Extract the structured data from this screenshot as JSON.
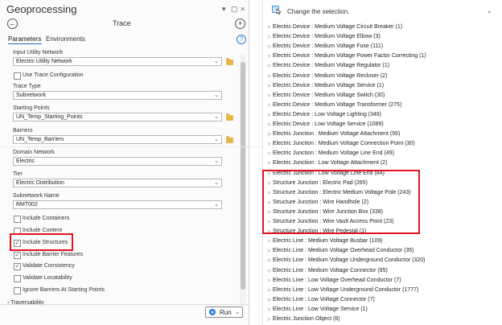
{
  "gp": {
    "title": "Geoprocessing",
    "header_controls": [
      "▾",
      "▢",
      "×"
    ],
    "back": "←",
    "add": "+",
    "tool_title": "Trace",
    "tabs": [
      "Parameters",
      "Environments"
    ],
    "help": "?",
    "input_network_label": "Input Utility Network",
    "input_network_value": "Electric Utility Network",
    "use_trace_config_label": "Use Trace Configuration",
    "trace_type_label": "Trace Type",
    "trace_type_value": "Subnetwork",
    "starting_points_label": "Starting Points",
    "starting_points_value": "UN_Temp_Starting_Points",
    "barriers_label": "Barriers",
    "barriers_value": "UN_Temp_Barriers",
    "domain_network_label": "Domain Network",
    "domain_network_value": "Electric",
    "tier_label": "Tier",
    "tier_value": "Electric Distribution",
    "subnetwork_name_label": "Subnetwork Name",
    "subnetwork_name_value": "RMT002",
    "checkboxes": [
      {
        "label": "Include Containers",
        "checked": false
      },
      {
        "label": "Include Content",
        "checked": false
      },
      {
        "label": "Include Structures",
        "checked": true
      },
      {
        "label": "Include Barrier Features",
        "checked": true
      },
      {
        "label": "Validate Consistency",
        "checked": true
      },
      {
        "label": "Validate Locatability",
        "checked": false
      },
      {
        "label": "Ignore Barriers At Starting Points",
        "checked": false
      }
    ],
    "traversability_label": "Traversability",
    "run_label": "Run",
    "highlight_color": "#e0141e"
  },
  "selection": {
    "hint": "Change the selection.",
    "highlight_color": "#e0141e",
    "rows": [
      "Electric Device : Medium Voltage Circuit Breaker (1)",
      "Electric Device : Medium Voltage Elbow (3)",
      "Electric Device : Medium Voltage Fuse (111)",
      "Electric Device : Medium Voltage Power Factor Correcting (1)",
      "Electric Device : Medium Voltage Regulator (1)",
      "Electric Device : Medium Voltage Recloser (2)",
      "Electric Device : Medium Voltage Service (1)",
      "Electric Device : Medium Voltage Switch (30)",
      "Electric Device : Medium Voltage Transformer (275)",
      "Electric Device : Low Voltage Lighting (349)",
      "Electric Device : Low Voltage Service (1089)",
      "Electric Junction : Medium Voltage Attachment (56)",
      "Electric Junction : Medium Voltage Connection Point (30)",
      "Electric Junction : Medium Voltage Line End (49)",
      "Electric Junction : Low Voltage Attachment (2)",
      "Electric Junction : Low Voltage Line End (84)",
      "Structure Junction : Electric Pad (265)",
      "Structure Junction : Electric Medium Voltage Pole (243)",
      "Structure Junction : Wire Handhole (2)",
      "Structure Junction : Wire Junction Box (338)",
      "Structure Junction : Wire Vault Access Point (23)",
      "Structure Junction : Wire Pedestal (1)",
      "Electric Line : Medium Voltage Busbar (109)",
      "Electric Line : Medium Voltage Overhead Conductor (35)",
      "Electric Line : Medium Voltage Underground Conductor (320)",
      "Electric Line : Medium Voltage Connector (95)",
      "Electric Line : Low Voltage Overhead Conductor (7)",
      "Electric Line : Low Voltage Underground Conductor (1777)",
      "Electric Line : Low Voltage Connector (7)",
      "Electric Line : Low Voltage Service (1)",
      "Electric Junction Object (6)"
    ]
  }
}
